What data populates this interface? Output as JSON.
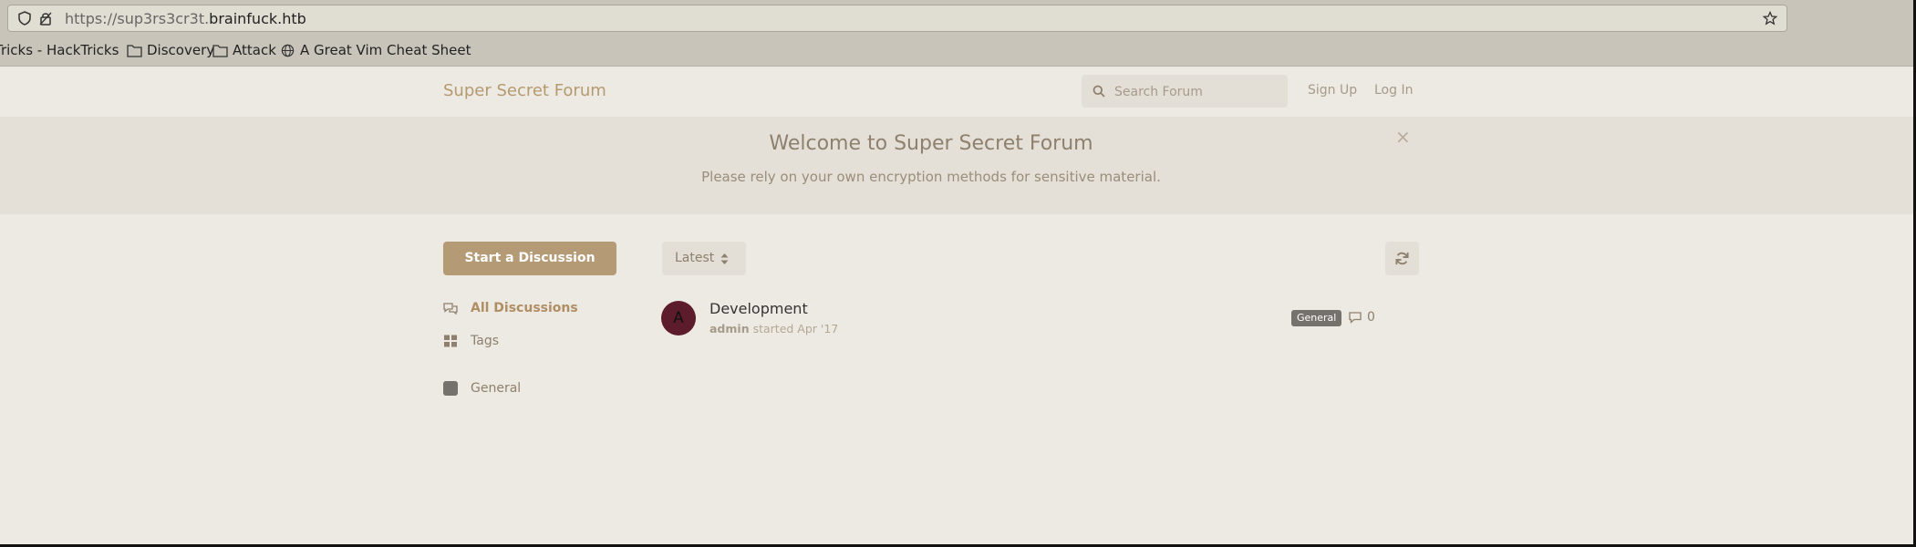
{
  "browser": {
    "url_prefix": "https://sup3rs3cr3t.",
    "url_domain": "brainfuck.htb",
    "bookmarks": [
      {
        "label": "Tricks - HackTricks",
        "icon": "none"
      },
      {
        "label": "Discovery",
        "icon": "folder-icon"
      },
      {
        "label": "Attack",
        "icon": "folder-icon"
      },
      {
        "label": "A Great Vim Cheat Sheet",
        "icon": "globe-icon"
      }
    ]
  },
  "forum": {
    "title": "Super Secret Forum",
    "search_placeholder": "Search Forum",
    "signup": "Sign Up",
    "login": "Log In"
  },
  "hero": {
    "title": "Welcome to Super Secret Forum",
    "subtitle": "Please rely on your own encryption methods for sensitive material.",
    "close": "×"
  },
  "sidebar": {
    "start_discussion": "Start a Discussion",
    "items": [
      {
        "label": "All Discussions",
        "icon": "comments-icon"
      },
      {
        "label": "Tags",
        "icon": "tags-grid-icon"
      },
      {
        "label": "General",
        "icon": "tag-square-icon"
      }
    ]
  },
  "toolbar": {
    "sort_label": "Latest"
  },
  "discussion": {
    "avatar_letter": "A",
    "title": "Development",
    "author": "admin",
    "meta": "started Apr '17",
    "tag": "General",
    "replies": "0"
  },
  "colors": {
    "accent": "#b59a76",
    "avatar": "#5c1c2c",
    "tag": "#75726d"
  }
}
